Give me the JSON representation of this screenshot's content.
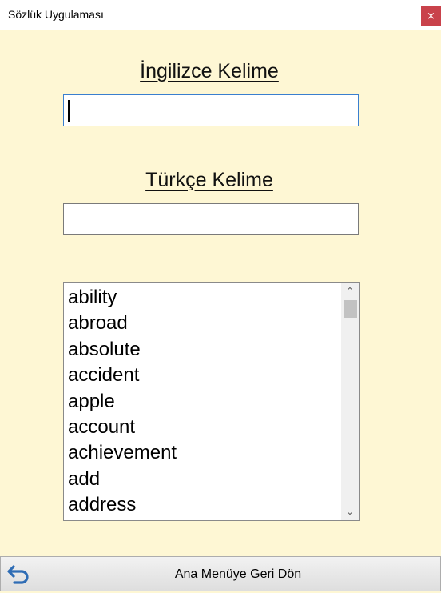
{
  "window": {
    "title": "Sözlük Uygulaması",
    "close_symbol": "×"
  },
  "form": {
    "english_label": "İngilizce Kelime",
    "english_value": "",
    "turkish_label": "Türkçe Kelime",
    "turkish_value": ""
  },
  "word_list": {
    "items": [
      "ability",
      "abroad",
      "absolute",
      "accident",
      "apple",
      "account",
      "achievement",
      "add",
      "address"
    ],
    "scroll_up_symbol": "⌃",
    "scroll_down_symbol": "⌄"
  },
  "footer": {
    "back_label": "Ana Menüye Geri Dön",
    "back_icon": "undo-arrow-icon",
    "icon_color": "#2f6db5"
  },
  "colors": {
    "background": "#fef7d4",
    "close_button": "#c9424b"
  }
}
